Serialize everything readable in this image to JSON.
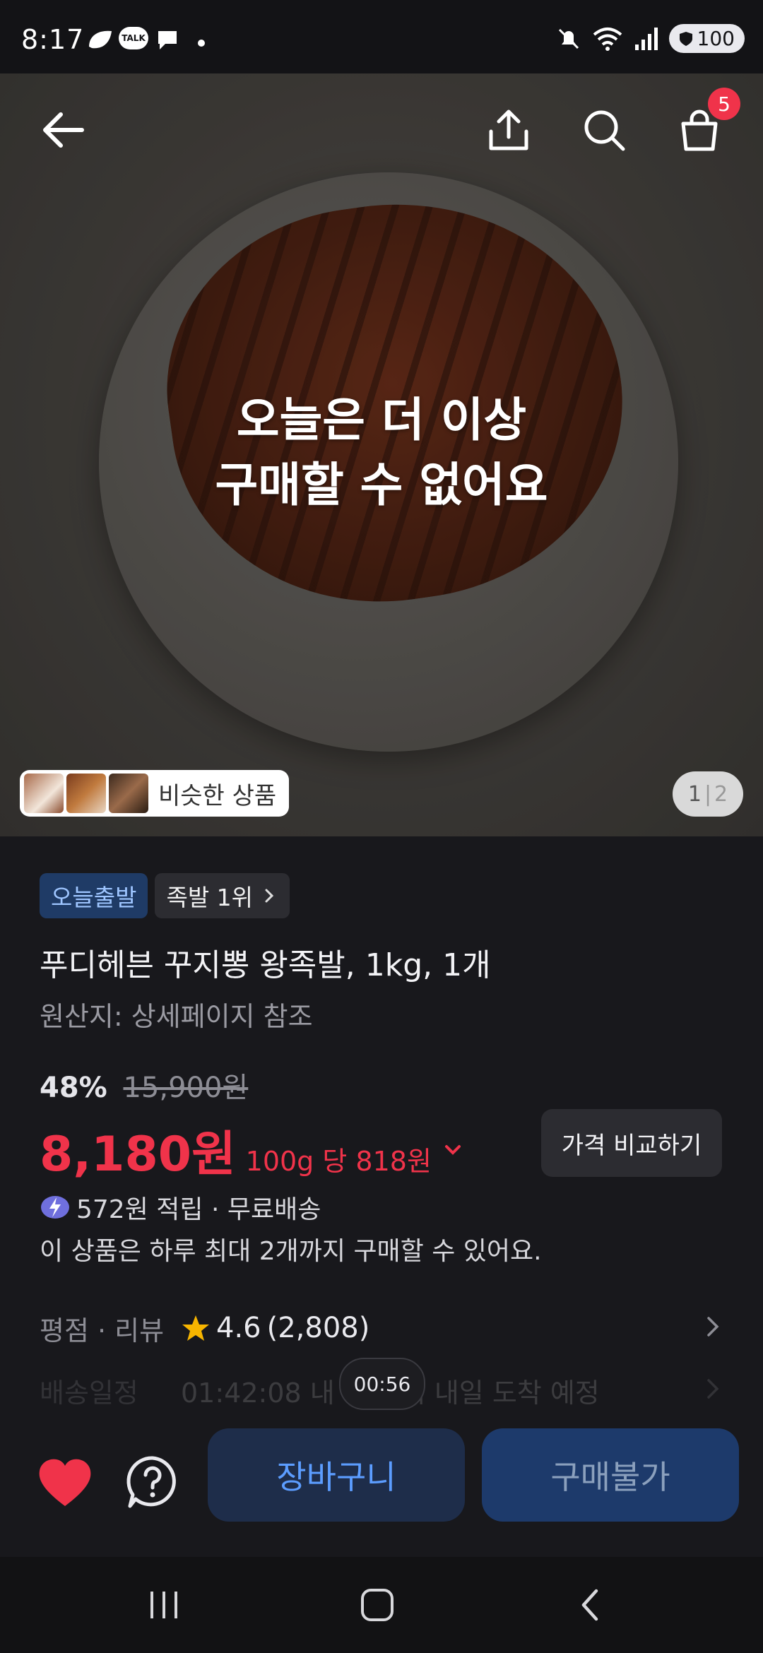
{
  "status_bar": {
    "time": "8:17",
    "notification_talk": "TALK",
    "battery": "100"
  },
  "hero": {
    "soldout_line1": "오늘은 더 이상",
    "soldout_line2": "구매할 수 없어요",
    "cart_count": "5",
    "similar_label": "비슷한 상품",
    "pager_current": "1",
    "pager_total": "2"
  },
  "product": {
    "badge_delivery": "오늘출발",
    "badge_rank": "족발 1위",
    "title": "푸디헤븐 꾸지뽕 왕족발, 1kg, 1개",
    "origin": "원산지: 상세페이지 참조",
    "discount_pct": "48%",
    "original_price": "15,900원",
    "price": "8,180원",
    "unit_price": "100g 당 818원",
    "compare_label": "가격 비교하기",
    "points": "572원 적립 · 무료배송",
    "purchase_limit": "이 상품은 하루 최대 2개까지 구매할 수 있어요."
  },
  "rating": {
    "label": "평점 · 리뷰",
    "score": "4.6",
    "count": "(2,808)"
  },
  "shipping": {
    "label": "배송일정",
    "value": "01:42:08 내 주문 시 내일 도착 예정"
  },
  "timer": "00:56",
  "actions": {
    "cart_label": "장바구니",
    "buy_label": "구매불가"
  },
  "colors": {
    "accent_red": "#f0334a",
    "accent_blue": "#5c9dff",
    "background": "#18181c"
  }
}
